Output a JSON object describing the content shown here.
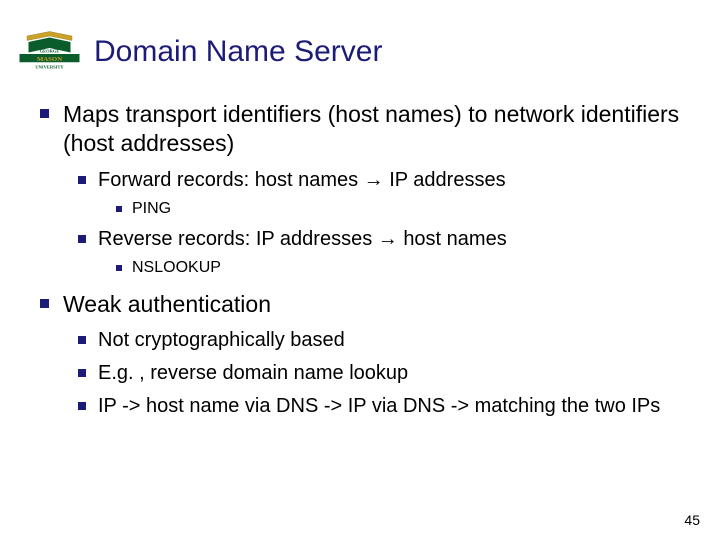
{
  "logo": {
    "top_label": "GEORGE",
    "main_label": "UNIVERSITY",
    "brand_name": "MASON"
  },
  "title": "Domain Name Server",
  "bullets": {
    "b1": {
      "text": "Maps transport identifiers (host names) to network identifiers (host addresses)",
      "sub": {
        "s1": {
          "text": "Forward records: host names → IP addresses",
          "sub": {
            "t1": "PING"
          }
        },
        "s2": {
          "text": "Reverse records: IP addresses → host names",
          "sub": {
            "t1": "NSLOOKUP"
          }
        }
      }
    },
    "b2": {
      "text": "Weak authentication",
      "sub": {
        "s1": "Not cryptographically based",
        "s2": "E.g. , reverse domain name lookup",
        "s3": "IP -> host name via DNS -> IP via DNS -> matching the two IPs"
      }
    }
  },
  "page_number": "45"
}
